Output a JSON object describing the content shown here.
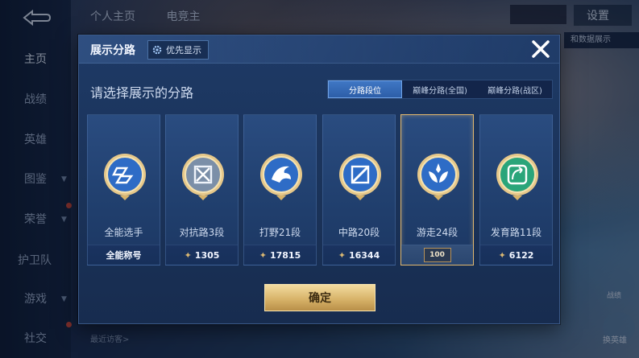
{
  "background": {
    "nav": [
      "主页",
      "战绩",
      "英雄",
      "图鉴",
      "荣誉",
      "护卫队",
      "游戏",
      "社交"
    ],
    "top_tabs": [
      "个人主页",
      "电竞主"
    ],
    "settings_label": "设置",
    "right_pill": "和数据展示",
    "visitors_label": "最近访客>",
    "bottom_right": [
      "战绩",
      "换英雄"
    ]
  },
  "dialog": {
    "title": "展示分路",
    "priority_label": "优先显示",
    "subtitle": "请选择展示的分路",
    "tabs": [
      {
        "label": "分路段位",
        "active": true
      },
      {
        "label": "巅峰分路(全国)",
        "active": false
      },
      {
        "label": "巅峰分路(战区)",
        "active": false
      }
    ],
    "cards": [
      {
        "name": "全能选手",
        "footer": "全能称号",
        "star": false,
        "selected": false,
        "icon": "all-round-badge-icon"
      },
      {
        "name": "对抗路3段",
        "footer": "1305",
        "star": true,
        "selected": false,
        "icon": "clash-lane-badge-icon"
      },
      {
        "name": "打野21段",
        "footer": "17815",
        "star": true,
        "selected": false,
        "icon": "jungle-badge-icon"
      },
      {
        "name": "中路20段",
        "footer": "16344",
        "star": true,
        "selected": false,
        "icon": "mid-lane-badge-icon"
      },
      {
        "name": "游走24段",
        "footer": "100",
        "star": false,
        "selected": true,
        "icon": "roam-badge-icon"
      },
      {
        "name": "发育路11段",
        "footer": "6122",
        "star": true,
        "selected": false,
        "icon": "farm-lane-badge-icon"
      }
    ],
    "confirm_label": "确定",
    "colors": {
      "gold": "#d8b46a",
      "active_tab": "#3f77c4",
      "panel": "#1e3a66"
    }
  }
}
